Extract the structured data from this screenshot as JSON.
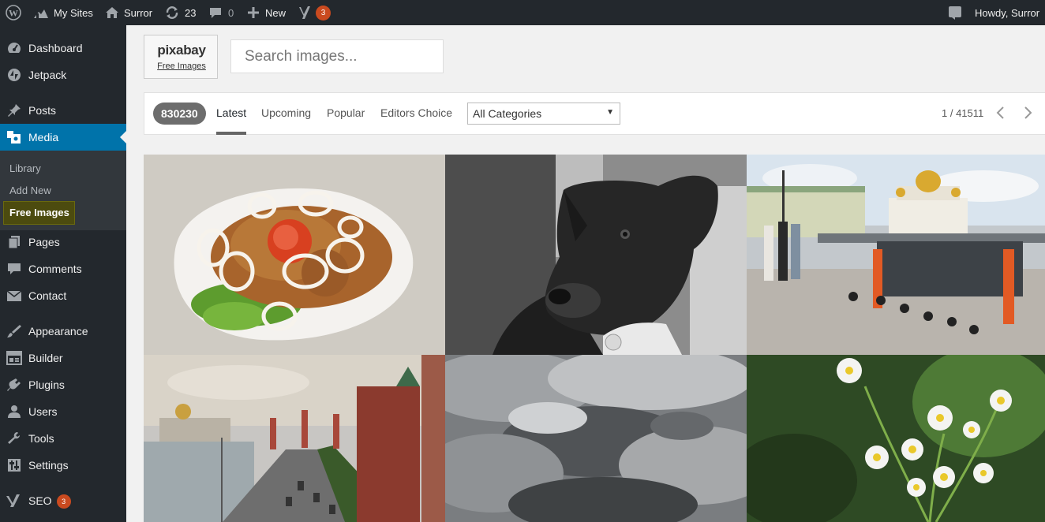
{
  "admin_bar": {
    "my_sites": "My Sites",
    "site_name": "Surror",
    "updates_count": "23",
    "comments_count": "0",
    "new_label": "New",
    "seo_badge": "3",
    "greeting": "Howdy, Surror"
  },
  "sidebar": {
    "items": [
      {
        "label": "Dashboard",
        "icon": "dashboard-icon"
      },
      {
        "label": "Jetpack",
        "icon": "jetpack-icon"
      },
      {
        "label": "Posts",
        "icon": "pin-icon"
      },
      {
        "label": "Media",
        "icon": "media-icon"
      },
      {
        "label": "Pages",
        "icon": "pages-icon"
      },
      {
        "label": "Comments",
        "icon": "comments-icon"
      },
      {
        "label": "Contact",
        "icon": "mail-icon"
      },
      {
        "label": "Appearance",
        "icon": "brush-icon"
      },
      {
        "label": "Builder",
        "icon": "builder-icon"
      },
      {
        "label": "Plugins",
        "icon": "plugin-icon"
      },
      {
        "label": "Users",
        "icon": "users-icon"
      },
      {
        "label": "Tools",
        "icon": "wrench-icon"
      },
      {
        "label": "Settings",
        "icon": "settings-icon"
      },
      {
        "label": "SEO",
        "icon": "yoast-icon",
        "badge": "3"
      }
    ],
    "submenu": [
      "Library",
      "Add New",
      "Free Images"
    ]
  },
  "brand": {
    "logo": "pixabay",
    "subtitle": "Free Images"
  },
  "search": {
    "placeholder": "Search images..."
  },
  "filters": {
    "count": "830230",
    "tabs": [
      "Latest",
      "Upcoming",
      "Popular",
      "Editors Choice"
    ],
    "active_tab": "Latest",
    "category": "All Categories",
    "pagination": "1 / 41511"
  },
  "colors": {
    "admin_bg": "#23282d",
    "active_blue": "#0073aa",
    "badge_orange": "#ca4a1f",
    "highlight_yellow": "#f6f300"
  }
}
